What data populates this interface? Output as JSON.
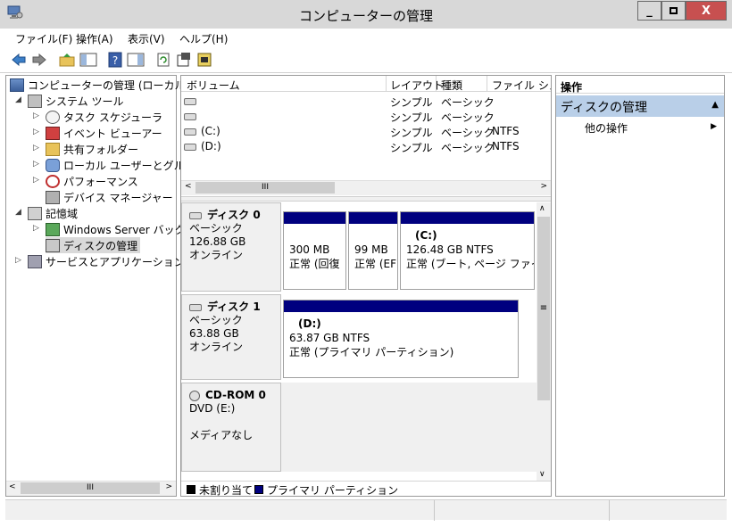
{
  "window": {
    "title": "コンピューターの管理",
    "minimize": "_",
    "maximize": "□",
    "close": "X"
  },
  "menu": {
    "file": "ファイル(F)",
    "action": "操作(A)",
    "view": "表示(V)",
    "help": "ヘルプ(H)"
  },
  "tree": {
    "root": "コンピューターの管理 (ローカル)",
    "system_tools": "システム ツール",
    "task_scheduler": "タスク スケジューラ",
    "event_viewer": "イベント ビューアー",
    "shared_folders": "共有フォルダー",
    "local_users": "ローカル ユーザーとグループ",
    "performance": "パフォーマンス",
    "device_manager": "デバイス マネージャー",
    "storage": "記憶域",
    "wsb": "Windows Server バックアップ",
    "disk_mgmt": "ディスクの管理",
    "services": "サービスとアプリケーション",
    "scroll_grip": "III"
  },
  "volumes": {
    "headers": [
      "ボリューム",
      "レイアウト",
      "種類",
      "ファイル システム"
    ],
    "rows": [
      {
        "name": "",
        "layout": "シンプル",
        "type": "ベーシック",
        "fs": ""
      },
      {
        "name": "",
        "layout": "シンプル",
        "type": "ベーシック",
        "fs": ""
      },
      {
        "name": "(C:)",
        "layout": "シンプル",
        "type": "ベーシック",
        "fs": "NTFS"
      },
      {
        "name": "(D:)",
        "layout": "シンプル",
        "type": "ベーシック",
        "fs": "NTFS"
      }
    ],
    "scroll_grip": "III"
  },
  "disks": [
    {
      "name": "ディスク 0",
      "type": "ベーシック",
      "size": "126.88 GB",
      "status": "オンライン",
      "partitions": [
        {
          "l1": "300 MB",
          "l2": "正常 (回復"
        },
        {
          "l1": "99 MB",
          "l2": "正常 (EF"
        },
        {
          "label": "(C:)",
          "l1": "126.48 GB NTFS",
          "l2": "正常 (ブート, ページ ファイル"
        }
      ]
    },
    {
      "name": "ディスク 1",
      "type": "ベーシック",
      "size": "63.88 GB",
      "status": "オンライン",
      "partitions": [
        {
          "label": "(D:)",
          "l1": "63.87 GB NTFS",
          "l2": "正常 (プライマリ パーティション)"
        }
      ]
    },
    {
      "name": "CD-ROM 0",
      "type": "DVD (E:)",
      "size": "",
      "status": "メディアなし"
    }
  ],
  "legend": {
    "unallocated": "未割り当て",
    "primary": "プライマリ パーティション"
  },
  "actions": {
    "header": "操作",
    "selected": "ディスクの管理",
    "more": "他の操作"
  },
  "colors": {
    "primary": "#00007f",
    "unallocated": "#000000",
    "selected_bg": "#b9cfe8"
  }
}
